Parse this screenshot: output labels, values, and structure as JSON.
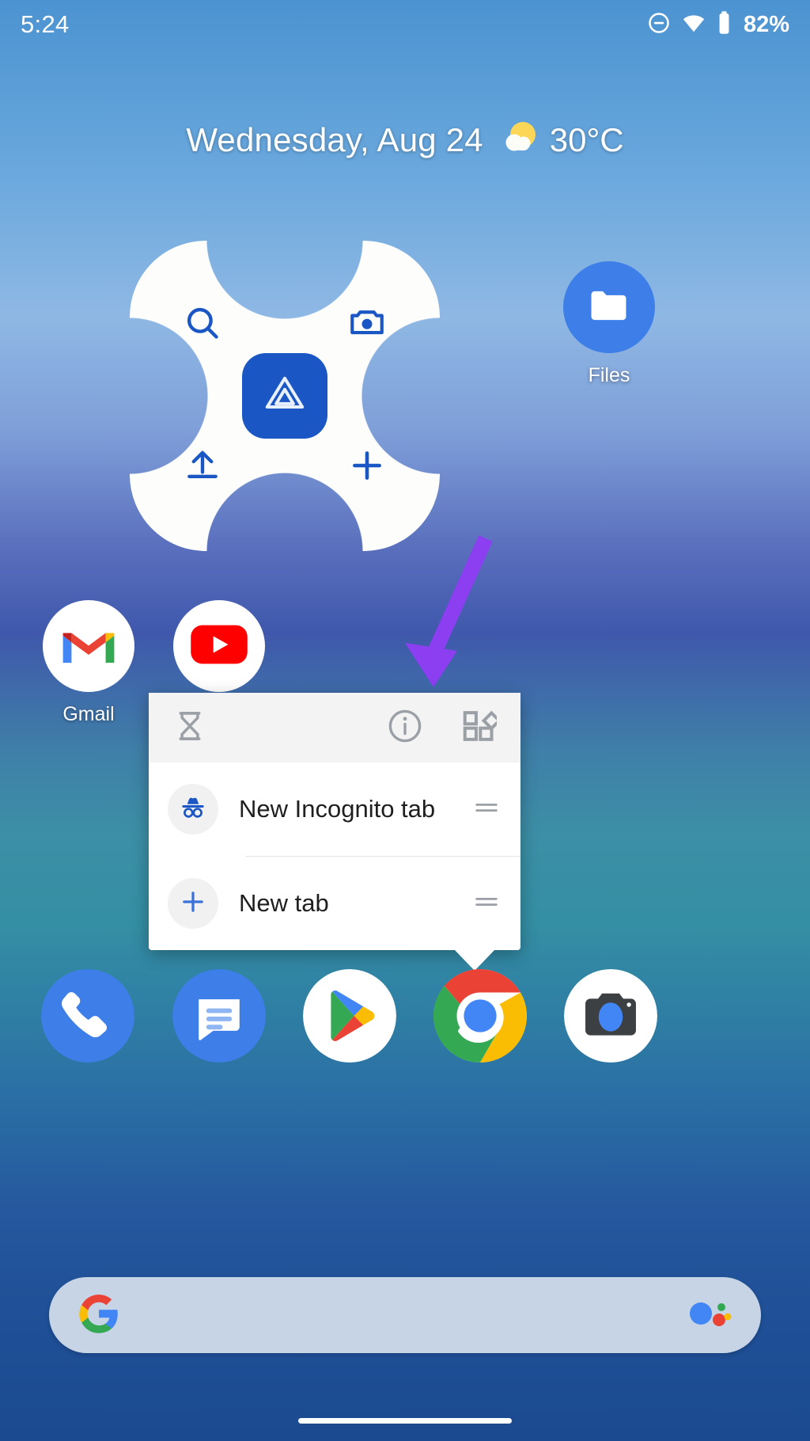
{
  "status_bar": {
    "time": "5:24",
    "battery_percent": "82%",
    "icons": [
      "do-not-disturb-icon",
      "wifi-icon",
      "battery-icon"
    ]
  },
  "date_widget": {
    "date": "Wednesday, Aug 24",
    "temperature": "30°C",
    "weather_icon": "partly-cloudy-icon"
  },
  "drive_widget": {
    "name": "Google Drive widget",
    "actions": [
      {
        "id": "search",
        "icon": "search-icon"
      },
      {
        "id": "scan",
        "icon": "camera-icon"
      },
      {
        "id": "upload",
        "icon": "upload-icon"
      },
      {
        "id": "new",
        "icon": "plus-icon"
      }
    ],
    "center_icon": "google-drive-icon",
    "accent": "#1a56c4"
  },
  "home_icons": [
    {
      "id": "files",
      "label": "Files",
      "icon": "folder-icon"
    },
    {
      "id": "gmail",
      "label": "Gmail",
      "icon": "gmail-icon"
    },
    {
      "id": "youtube",
      "label": "",
      "icon": "youtube-icon"
    }
  ],
  "annotation": {
    "type": "arrow",
    "color": "#8b3ff0"
  },
  "popup": {
    "header_icons": [
      {
        "id": "pause-app",
        "icon": "hourglass-icon"
      },
      {
        "id": "app-info",
        "icon": "info-icon"
      },
      {
        "id": "widgets",
        "icon": "widgets-icon"
      }
    ],
    "items": [
      {
        "label": "New Incognito tab",
        "icon": "incognito-icon",
        "handle": "drag-handle-icon"
      },
      {
        "label": "New tab",
        "icon": "plus-icon",
        "handle": "drag-handle-icon"
      }
    ]
  },
  "dock": [
    {
      "id": "phone",
      "icon": "phone-icon"
    },
    {
      "id": "messages",
      "icon": "messages-icon"
    },
    {
      "id": "play-store",
      "icon": "play-store-icon"
    },
    {
      "id": "chrome",
      "icon": "chrome-icon"
    },
    {
      "id": "camera",
      "icon": "camera-icon"
    }
  ],
  "search_bar": {
    "logo": "google-g-icon",
    "assistant": "google-assistant-icon",
    "placeholder": ""
  },
  "colors": {
    "google_blue": "#4285f4",
    "google_red": "#ea4335",
    "google_yellow": "#fbbc04",
    "google_green": "#34a853",
    "drive_blue": "#1a56c4",
    "arrow_purple": "#8b3ff0"
  }
}
